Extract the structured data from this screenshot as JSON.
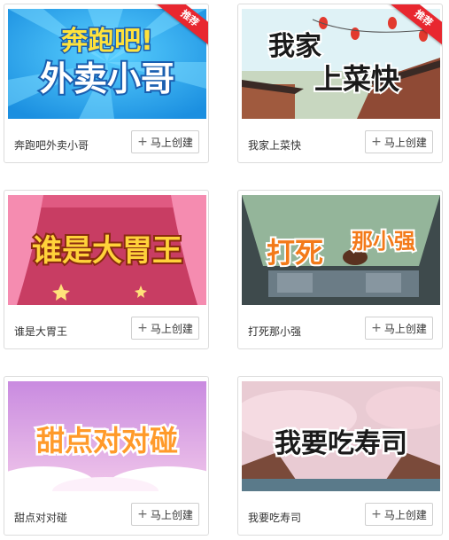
{
  "cards": [
    {
      "title": "奔跑吧外卖小哥",
      "button_label": "马上创建",
      "ribbon": "推荐",
      "art_line1": "奔跑吧!",
      "art_line2": "外卖小哥"
    },
    {
      "title": "我家上菜快",
      "button_label": "马上创建",
      "ribbon": "推荐",
      "art_line1": "我家",
      "art_line2": "上菜快"
    },
    {
      "title": "谁是大胃王",
      "button_label": "马上创建",
      "art_line1": "谁是大胃王"
    },
    {
      "title": "打死那小强",
      "button_label": "马上创建",
      "art_line1": "打死",
      "art_line2": "那小强"
    },
    {
      "title": "甜点对对碰",
      "button_label": "马上创建",
      "art_line1": "甜点对对碰"
    },
    {
      "title": "我要吃寿司",
      "button_label": "马上创建",
      "art_line1": "我要吃寿司"
    }
  ],
  "colors": {
    "ribbon": "#e8272f",
    "card_border": "#dcdcdc",
    "text": "#333333"
  }
}
